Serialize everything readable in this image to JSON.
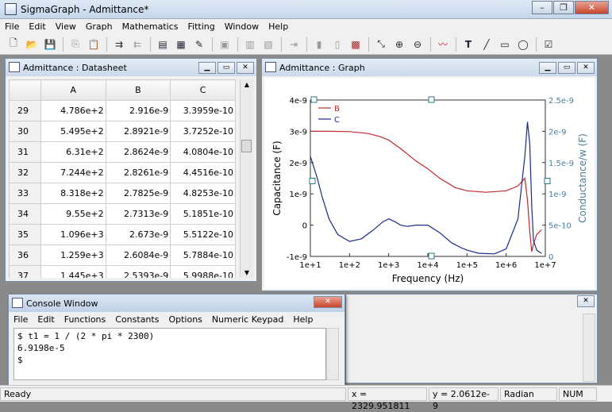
{
  "app": {
    "title": "SigmaGraph - Admittance*"
  },
  "menu": [
    "File",
    "Edit",
    "View",
    "Graph",
    "Mathematics",
    "Fitting",
    "Window",
    "Help"
  ],
  "datasheet": {
    "title": "Admittance : Datasheet",
    "columns": [
      "A",
      "B",
      "C"
    ],
    "rows": [
      {
        "n": "29",
        "a": "4.786e+2",
        "b": "2.916e-9",
        "c": "3.3959e-10"
      },
      {
        "n": "30",
        "a": "5.495e+2",
        "b": "2.8921e-9",
        "c": "3.7252e-10"
      },
      {
        "n": "31",
        "a": "6.31e+2",
        "b": "2.8624e-9",
        "c": "4.0804e-10"
      },
      {
        "n": "32",
        "a": "7.244e+2",
        "b": "2.8261e-9",
        "c": "4.4516e-10"
      },
      {
        "n": "33",
        "a": "8.318e+2",
        "b": "2.7825e-9",
        "c": "4.8253e-10"
      },
      {
        "n": "34",
        "a": "9.55e+2",
        "b": "2.7313e-9",
        "c": "5.1851e-10"
      },
      {
        "n": "35",
        "a": "1.096e+3",
        "b": "2.673e-9",
        "c": "5.5122e-10"
      },
      {
        "n": "36",
        "a": "1.259e+3",
        "b": "2.6084e-9",
        "c": "5.7884e-10"
      },
      {
        "n": "37",
        "a": "1.445e+3",
        "b": "2.5393e-9",
        "c": "5.9988e-10"
      }
    ]
  },
  "graph": {
    "title": "Admittance : Graph"
  },
  "chart_data": {
    "type": "line",
    "xlabel": "Frequency (Hz)",
    "ylabel": "Capacitance (F)",
    "y2label": "Conductance/w (F)",
    "x_scale": "log",
    "xlim": [
      10,
      10000000
    ],
    "ylim": [
      -1e-09,
      4e-09
    ],
    "y2lim": [
      0,
      2.5e-09
    ],
    "x_ticks": [
      "1e+1",
      "1e+2",
      "1e+3",
      "1e+4",
      "1e+5",
      "1e+6",
      "1e+7"
    ],
    "y_ticks": [
      "-1e-9",
      "0",
      "1e-9",
      "2e-9",
      "3e-9",
      "4e-9"
    ],
    "y2_ticks": [
      "0",
      "5e-10",
      "1e-9",
      "1.5e-9",
      "2e-9",
      "2.5e-9"
    ],
    "legend_position": "top-left",
    "series": [
      {
        "name": "B",
        "axis": "left",
        "color": "#c0282d",
        "x": [
          10,
          30,
          100,
          300,
          600,
          1000,
          2000,
          5000,
          10000,
          20000,
          50000,
          100000,
          300000,
          1000000,
          2000000,
          3000000,
          3500000,
          4000000,
          4500000,
          5000000,
          6000000,
          8000000
        ],
        "y": [
          3e-09,
          3e-09,
          2.99e-09,
          2.93e-09,
          2.83e-09,
          2.72e-09,
          2.45e-09,
          2.05e-09,
          1.8e-09,
          1.5e-09,
          1.2e-09,
          1.1e-09,
          1.05e-09,
          1.1e-09,
          1.25e-09,
          1.5e-09,
          8e-10,
          -2e-10,
          -8.5e-10,
          -6e-10,
          -3e-10,
          -1.5e-10
        ]
      },
      {
        "name": "C",
        "axis": "right",
        "color": "#1a2a8c",
        "x": [
          10,
          15,
          20,
          30,
          50,
          100,
          200,
          400,
          700,
          1000,
          1500,
          2000,
          3000,
          5000,
          10000,
          20000,
          40000,
          70000,
          100000,
          200000,
          500000,
          1000000,
          2000000,
          3000000,
          3500000,
          4000000,
          4500000,
          5000000,
          6000000,
          8000000
        ],
        "y": [
          1.6e-09,
          1.25e-09,
          9.5e-10,
          6e-10,
          3.5e-10,
          2.4e-10,
          2.8e-10,
          4.2e-10,
          5.5e-10,
          6e-10,
          5.5e-10,
          5e-10,
          4.8e-10,
          5e-10,
          5e-10,
          3.8e-10,
          2.2e-10,
          1.4e-10,
          1e-10,
          5e-11,
          4e-11,
          1.2e-10,
          6e-10,
          1.6e-09,
          2.15e-09,
          1.8e-09,
          8e-10,
          2.5e-10,
          1e-10,
          5e-11
        ]
      }
    ]
  },
  "console": {
    "title": "Console Window",
    "menu": [
      "File",
      "Edit",
      "Functions",
      "Constants",
      "Options",
      "Numeric Keypad",
      "Help"
    ],
    "lines": [
      "$ t1 = 1 / (2 * pi * 2300)",
      "6.9198e-5",
      "$"
    ]
  },
  "status": {
    "ready": "Ready",
    "x": "x = 2329.951811",
    "y": "y = 2.0612e-9",
    "angle": "Radian",
    "num": "NUM"
  }
}
